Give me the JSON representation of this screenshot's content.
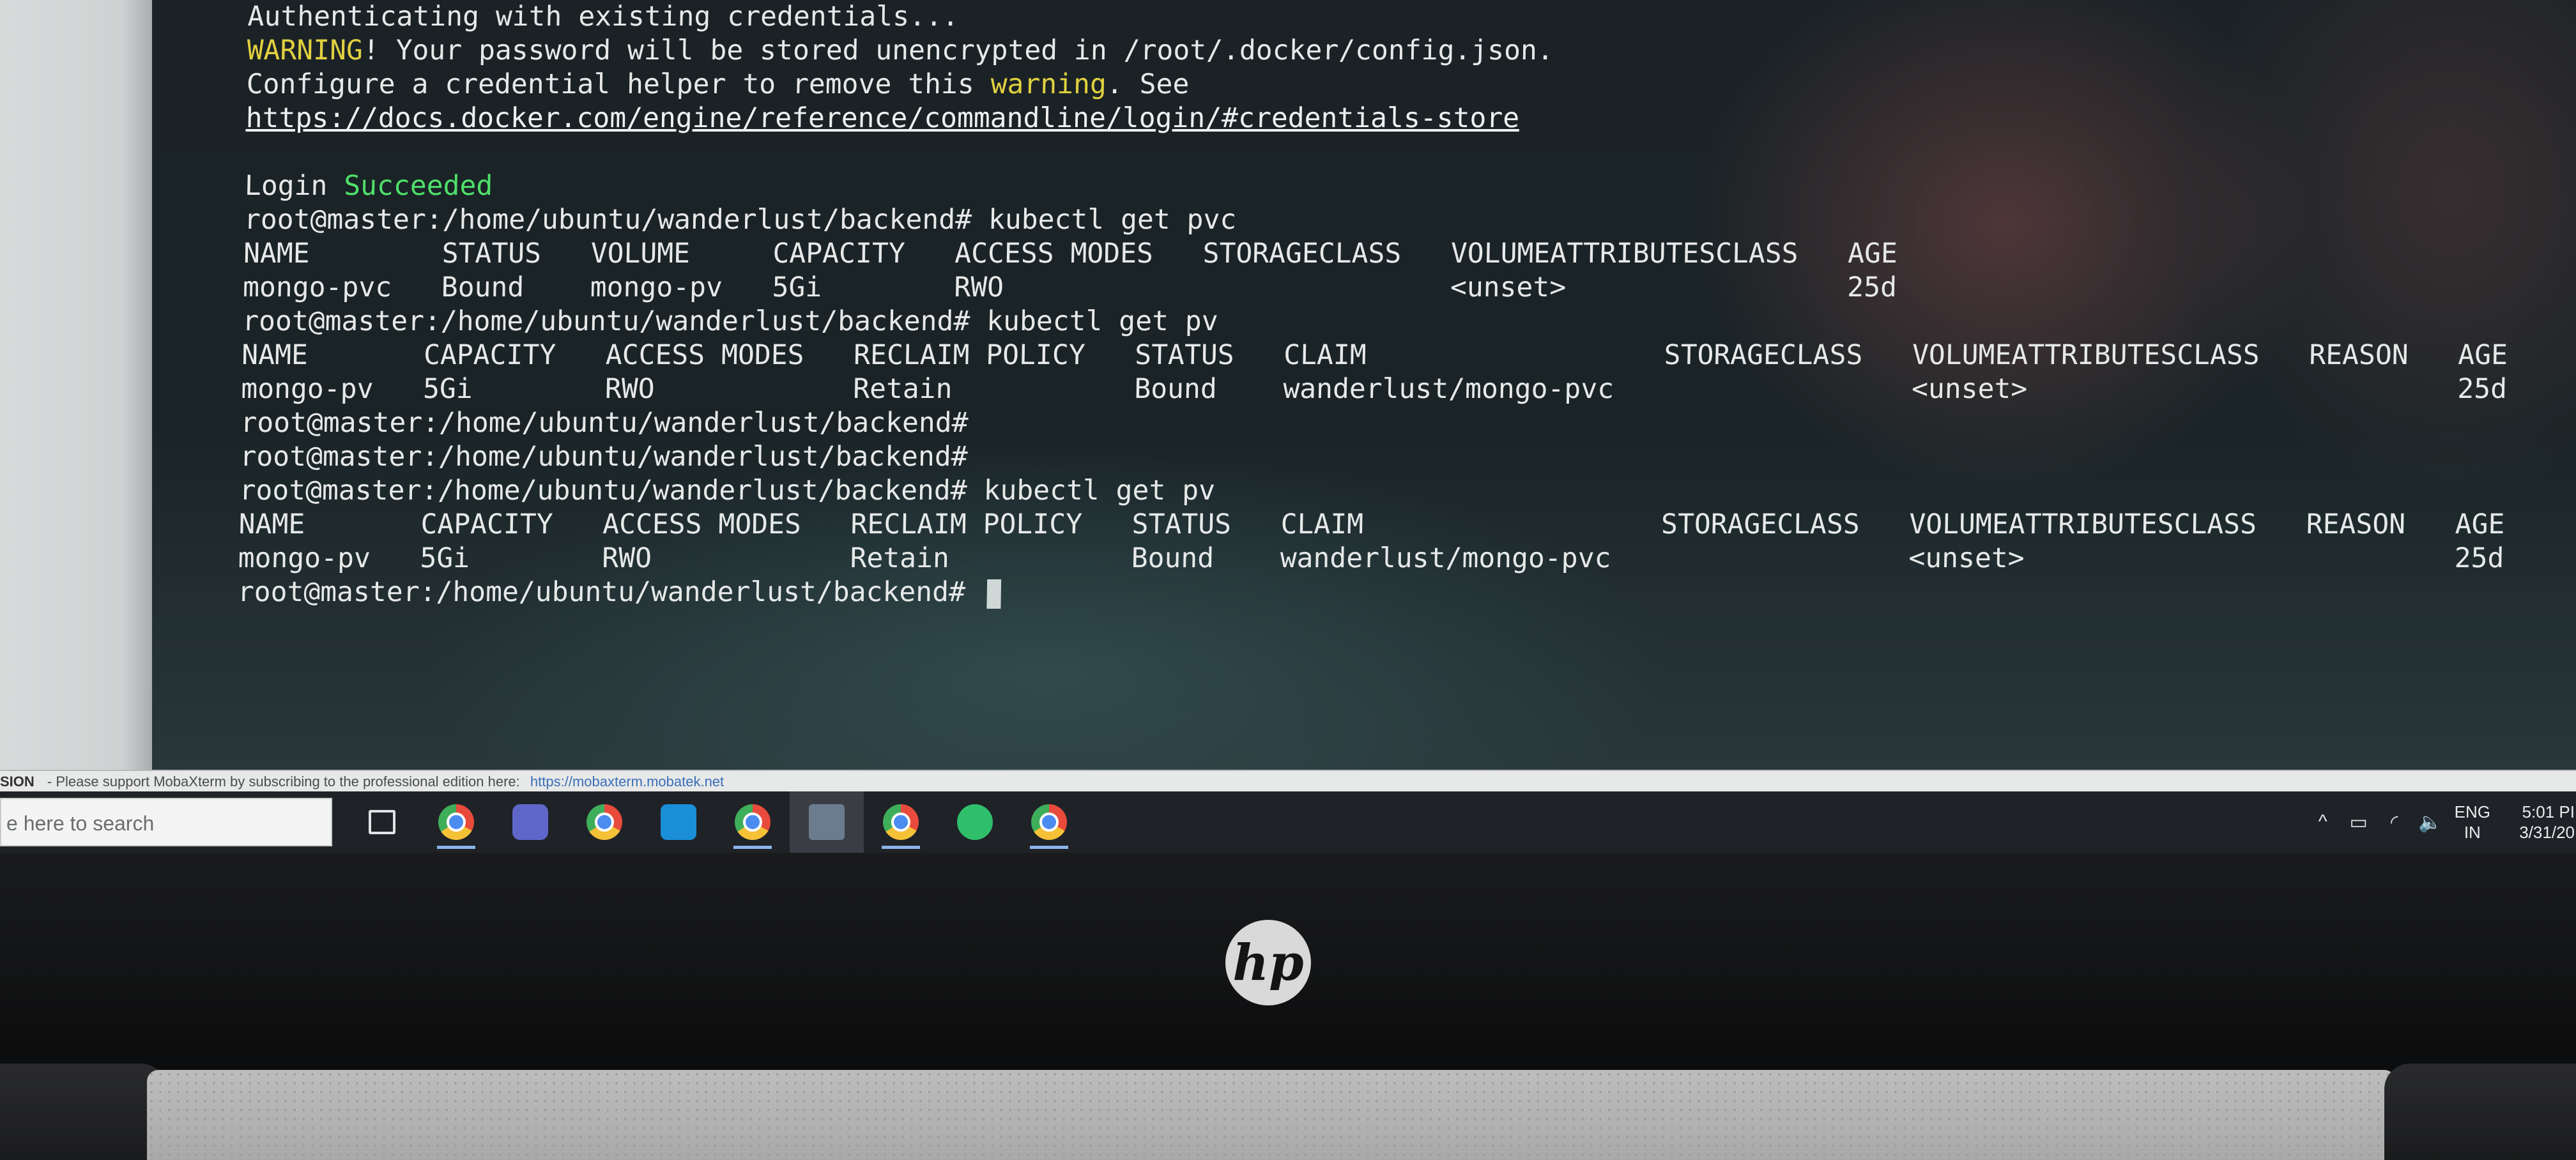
{
  "terminal": {
    "lines": [
      {
        "segments": [
          {
            "text": "Authenticating with existing credentials..."
          }
        ]
      },
      {
        "segments": [
          {
            "text": "WARNING",
            "color": "yellow"
          },
          {
            "text": "! Your password will be stored unencrypted in /root/.docker/config.json."
          }
        ]
      },
      {
        "segments": [
          {
            "text": "Configure a credential helper to remove this "
          },
          {
            "text": "warning",
            "color": "yellow"
          },
          {
            "text": ". See"
          }
        ]
      },
      {
        "segments": [
          {
            "text": "https://docs.docker.com/engine/reference/commandline/login/#credentials-store",
            "link": true
          }
        ]
      },
      {
        "segments": [
          {
            "text": ""
          }
        ]
      },
      {
        "segments": [
          {
            "text": "Login "
          },
          {
            "text": "Succeeded",
            "color": "green"
          }
        ]
      },
      {
        "segments": [
          {
            "text": "root@master:/home/ubuntu/wanderlust/backend# kubectl get pvc"
          }
        ]
      },
      {
        "segments": [
          {
            "text": "NAME        STATUS   VOLUME     CAPACITY   ACCESS MODES   STORAGECLASS   VOLUMEATTRIBUTESCLASS   AGE"
          }
        ]
      },
      {
        "segments": [
          {
            "text": "mongo-pvc   Bound    mongo-pv   5Gi        RWO                           <unset>                 25d"
          }
        ]
      },
      {
        "segments": [
          {
            "text": "root@master:/home/ubuntu/wanderlust/backend# kubectl get pv"
          }
        ]
      },
      {
        "segments": [
          {
            "text": "NAME       CAPACITY   ACCESS MODES   RECLAIM POLICY   STATUS   CLAIM                  STORAGECLASS   VOLUMEATTRIBUTESCLASS   REASON   AGE"
          }
        ]
      },
      {
        "segments": [
          {
            "text": "mongo-pv   5Gi        RWO            Retain           Bound    wanderlust/mongo-pvc                  <unset>                          25d"
          }
        ]
      },
      {
        "segments": [
          {
            "text": "root@master:/home/ubuntu/wanderlust/backend#"
          }
        ]
      },
      {
        "segments": [
          {
            "text": "root@master:/home/ubuntu/wanderlust/backend#"
          }
        ]
      },
      {
        "segments": [
          {
            "text": "root@master:/home/ubuntu/wanderlust/backend# kubectl get pv"
          }
        ]
      },
      {
        "segments": [
          {
            "text": "NAME       CAPACITY   ACCESS MODES   RECLAIM POLICY   STATUS   CLAIM                  STORAGECLASS   VOLUMEATTRIBUTESCLASS   REASON   AGE"
          }
        ]
      },
      {
        "segments": [
          {
            "text": "mongo-pv   5Gi        RWO            Retain           Bound    wanderlust/mongo-pvc                  <unset>                          25d"
          }
        ]
      },
      {
        "segments": [
          {
            "text": "root@master:/home/ubuntu/wanderlust/backend# "
          }
        ],
        "cursor": true
      }
    ],
    "colors": {
      "yellow": "#e0d040",
      "green": "#4fe06a",
      "text": "#e6e9e8"
    }
  },
  "moba_strip": {
    "session_label": "SION",
    "message": "- Please support MobaXterm by subscribing to the professional edition here:",
    "link": "https://mobaxterm.mobatek.net"
  },
  "taskbar": {
    "search_placeholder": "e here to search",
    "icons": [
      {
        "name": "task-view-icon",
        "kind": "taskview"
      },
      {
        "name": "chrome-icon",
        "kind": "chrome",
        "active": true
      },
      {
        "name": "teams-icon",
        "kind": "teams"
      },
      {
        "name": "chrome-icon",
        "kind": "chrome"
      },
      {
        "name": "edge-icon",
        "kind": "edge"
      },
      {
        "name": "chrome-profile-icon",
        "kind": "chrome",
        "active": true
      },
      {
        "name": "photos-icon",
        "kind": "photos",
        "selected": true
      },
      {
        "name": "chrome-profile-icon",
        "kind": "chrome",
        "active": true
      },
      {
        "name": "whatsapp-icon",
        "kind": "whatsapp"
      },
      {
        "name": "chrome-icon",
        "kind": "chrome",
        "active": true
      }
    ],
    "tray": {
      "language_top": "ENG",
      "language_bottom": "IN",
      "time": "5:01 PI",
      "date": "3/31/20"
    }
  },
  "laptop": {
    "logo_text": "hp"
  }
}
